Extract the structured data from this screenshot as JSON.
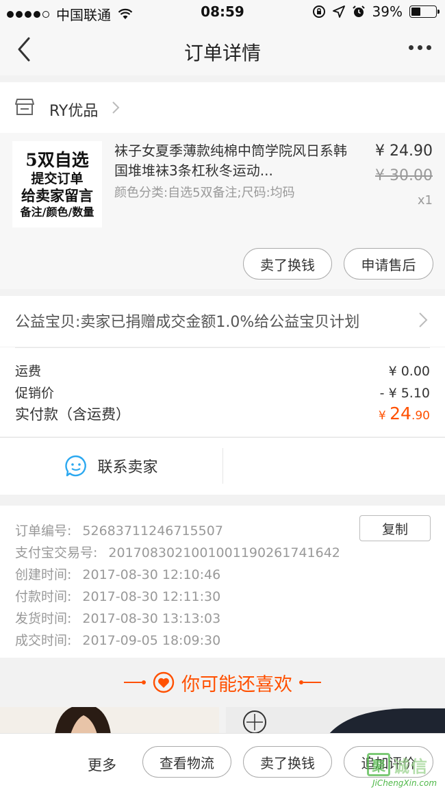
{
  "status_bar": {
    "carrier": "中国联通",
    "time": "08:59",
    "battery": "39%",
    "battery_level": 0.39
  },
  "nav": {
    "title": "订单详情"
  },
  "shop": {
    "name": "RY优品"
  },
  "product": {
    "image_lines": [
      "5双自选",
      "提交订单",
      "给卖家留言",
      "备注/颜色/数量"
    ],
    "title": "袜子女夏季薄款纯棉中筒学院风日系韩国堆堆袜3条杠秋冬运动...",
    "sku": "颜色分类:自选5双备注;尺码:均码",
    "price": "¥ 24.90",
    "original_price": "¥ 30.00",
    "quantity": "x1",
    "actions": [
      "卖了换钱",
      "申请售后"
    ]
  },
  "charity": {
    "text": "公益宝贝:卖家已捐赠成交金额1.0%给公益宝贝计划"
  },
  "costs": {
    "shipping_label": "运费",
    "shipping_value": "¥ 0.00",
    "promo_label": "促销价",
    "promo_value": "- ¥ 5.10",
    "total_label": "实付款（含运费）",
    "total_currency": "¥",
    "total_integer": "24",
    "total_decimal": ".90"
  },
  "contact": {
    "label": "联系卖家"
  },
  "order_info": {
    "copy_label": "复制",
    "rows": [
      {
        "label": "订单编号:",
        "value": "52683711246715507"
      },
      {
        "label": "支付宝交易号:",
        "value": "2017083021001001190261741642"
      },
      {
        "label": "创建时间:",
        "value": "2017-08-30 12:10:46"
      },
      {
        "label": "付款时间:",
        "value": "2017-08-30 12:11:30"
      },
      {
        "label": "发货时间:",
        "value": "2017-08-30 13:13:03"
      },
      {
        "label": "成交时间:",
        "value": "2017-09-05 18:09:30"
      }
    ]
  },
  "recommend": {
    "title": "你可能还喜欢"
  },
  "bottom_bar": {
    "more_label": "更多",
    "buttons": [
      "查看物流",
      "卖了换钱",
      "追加评价"
    ]
  },
  "watermark": {
    "mark": "聚",
    "text": "诚信",
    "url": "JiChengXin.com"
  },
  "colors": {
    "accent": "#ff5000",
    "watermark_green": "#4fb848"
  }
}
